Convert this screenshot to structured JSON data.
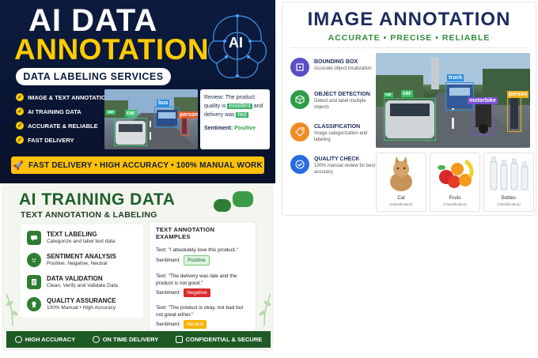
{
  "panel1": {
    "title_line1": "AI DATA",
    "title_line2": "ANNOTATION",
    "subtitle": "DATA LABELING SERVICES",
    "brain_label": "AI",
    "features": [
      "IMAGE & TEXT ANNOTATION",
      "AI TRAINING DATA",
      "ACCURATE & RELIABLE",
      "FAST DELIVERY"
    ],
    "photo_labels": [
      "car",
      "bus",
      "person",
      "car"
    ],
    "review": {
      "prefix": "Review: The product quality is ",
      "highlight1": "excellent",
      "middle": " and delivery was ",
      "highlight2": "fast",
      "suffix": ".",
      "sentiment_label": "Sentiment: ",
      "sentiment_value": "Positive"
    },
    "banner": "FAST DELIVERY  •  HIGH ACCURACY  •  100% MANUAL WORK",
    "colors": {
      "bg": "#0c1b3f",
      "accent": "#ffcc00"
    }
  },
  "panel2": {
    "title": "IMAGE ANNOTATION",
    "subtitle": "ACCURATE • PRECISE • RELIABLE",
    "items": [
      {
        "icon": "bounding-box-icon",
        "title": "BOUNDING BOX",
        "desc": "Accurate object localization",
        "color": "#5b4fc4"
      },
      {
        "icon": "cube-icon",
        "title": "OBJECT DETECTION",
        "desc": "Detect and label multiple objects",
        "color": "#2e9c4a"
      },
      {
        "icon": "tag-icon",
        "title": "CLASSIFICATION",
        "desc": "Image categorization and labeling",
        "color": "#f08a24"
      },
      {
        "icon": "check-icon",
        "title": "QUALITY CHECK",
        "desc": "100% manual review for best accuracy",
        "color": "#2a6be0"
      }
    ],
    "photo_labels": {
      "truck": "truck",
      "car": "car",
      "car2": "car",
      "motorbike": "motorbike",
      "person": "person"
    },
    "thumbs": [
      {
        "name": "Cat",
        "sub": "(Classification)"
      },
      {
        "name": "Fruits",
        "sub": "(Classification)"
      },
      {
        "name": "Bottles",
        "sub": "(Classification)"
      }
    ]
  },
  "panel3": {
    "title": "AI TRAINING DATA",
    "subtitle": "TEXT ANNOTATION & LABELING",
    "items": [
      {
        "title": "TEXT LABELING",
        "desc": "Categorize and label text data"
      },
      {
        "title": "SENTIMENT ANALYSIS",
        "desc": "Positive, Negative, Neutral"
      },
      {
        "title": "DATA VALIDATION",
        "desc": "Clean, Verify and Validate Data"
      },
      {
        "title": "QUALITY ASSURANCE",
        "desc": "100% Manual • High Accuracy"
      }
    ],
    "examples_title": "TEXT ANNOTATION EXAMPLES",
    "examples": [
      {
        "text": "Text: \"I absolutely love this product.\"",
        "label": "Sentiment:",
        "value": "Positive",
        "color": "#dff3df",
        "fg": "#1f6a2a"
      },
      {
        "text": "Text: \"The delivery was late and the product is not good.\"",
        "label": "Sentiment:",
        "value": "Negative",
        "color": "#d92b2b",
        "fg": "#ffffff"
      },
      {
        "text": "Text: \"The product is okay, not bad but not great either.\"",
        "label": "Sentiment:",
        "value": "Neutral",
        "color": "#f4b400",
        "fg": "#ffffff"
      }
    ],
    "footer": [
      "HIGH ACCURACY",
      "ON TIME DELIVERY",
      "CONFIDENTIAL & SECURE"
    ]
  }
}
